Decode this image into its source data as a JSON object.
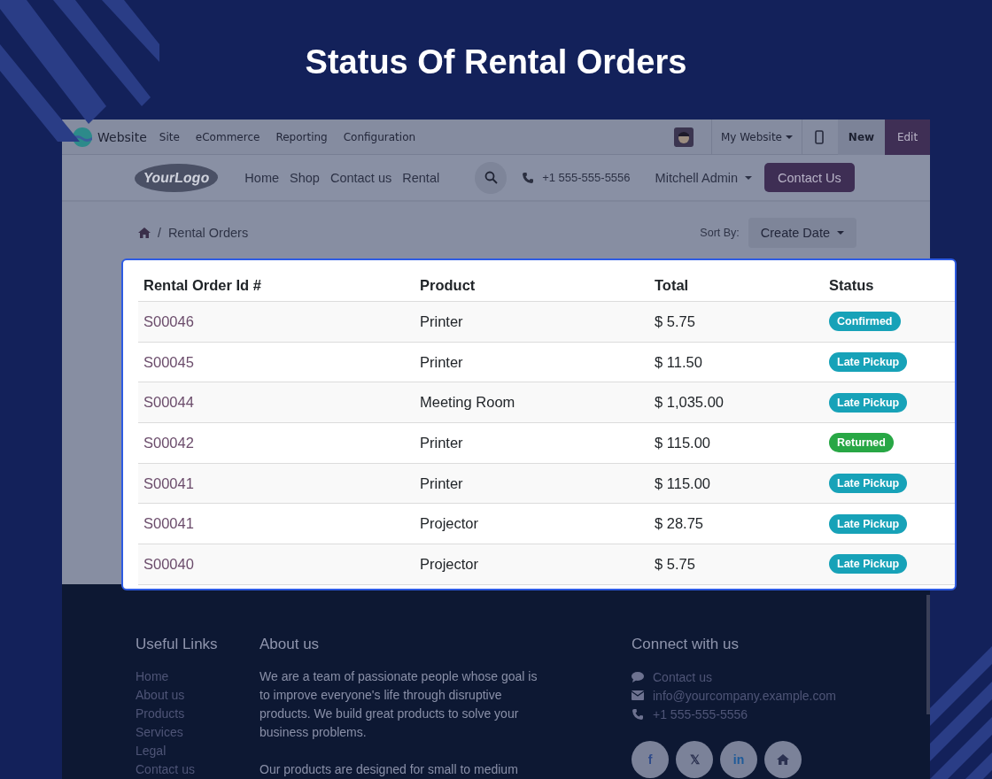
{
  "title": "Status Of Rental Orders",
  "admin_bar": {
    "app": "Website",
    "menu": [
      "Site",
      "eCommerce",
      "Reporting",
      "Configuration"
    ],
    "website": "My Website",
    "new": "New",
    "edit": "Edit"
  },
  "header": {
    "logo": "YourLogo",
    "nav": [
      "Home",
      "Shop",
      "Contact us",
      "Rental"
    ],
    "phone": "+1 555-555-5556",
    "user": "Mitchell Admin",
    "cta": "Contact Us"
  },
  "breadcrumb_separator": "/",
  "breadcrumb": "Rental Orders",
  "sort": {
    "label": "Sort By:",
    "value": "Create Date"
  },
  "table": {
    "columns": [
      "Rental Order Id #",
      "Product",
      "Total",
      "Status"
    ],
    "rows": [
      {
        "id": "S00046",
        "product": "Printer",
        "total": "$ 5.75",
        "status": "Confirmed",
        "color": "#17a2b8"
      },
      {
        "id": "S00045",
        "product": "Printer",
        "total": "$ 11.50",
        "status": "Late Pickup",
        "color": "#17a2b8"
      },
      {
        "id": "S00044",
        "product": "Meeting Room",
        "total": "$ 1,035.00",
        "status": "Late Pickup",
        "color": "#17a2b8"
      },
      {
        "id": "S00042",
        "product": "Printer",
        "total": "$ 115.00",
        "status": "Returned",
        "color": "#28a745"
      },
      {
        "id": "S00041",
        "product": "Printer",
        "total": "$ 115.00",
        "status": "Late Pickup",
        "color": "#17a2b8"
      },
      {
        "id": "S00041",
        "product": "Projector",
        "total": "$ 28.75",
        "status": "Late Pickup",
        "color": "#17a2b8"
      },
      {
        "id": "S00040",
        "product": "Projector",
        "total": "$ 5.75",
        "status": "Late Pickup",
        "color": "#17a2b8"
      }
    ]
  },
  "footer": {
    "links_title": "Useful Links",
    "links": [
      "Home",
      "About us",
      "Products",
      "Services",
      "Legal",
      "Contact us"
    ],
    "about_title": "About us",
    "about": [
      "We are a team of passionate people whose goal is to improve everyone's life through disruptive products. We build great products to solve your business problems.",
      "Our products are designed for small to medium"
    ],
    "connect_title": "Connect with us",
    "contacts": [
      {
        "kind": "chat",
        "text": "Contact us"
      },
      {
        "kind": "mail",
        "text": "info@yourcompany.example.com"
      },
      {
        "kind": "phone",
        "text": "+1 555-555-5556"
      }
    ],
    "social": [
      {
        "kind": "text",
        "text": "f"
      },
      {
        "kind": "text",
        "text": "𝕏"
      },
      {
        "kind": "text",
        "text": "in"
      },
      {
        "kind": "home"
      }
    ]
  }
}
